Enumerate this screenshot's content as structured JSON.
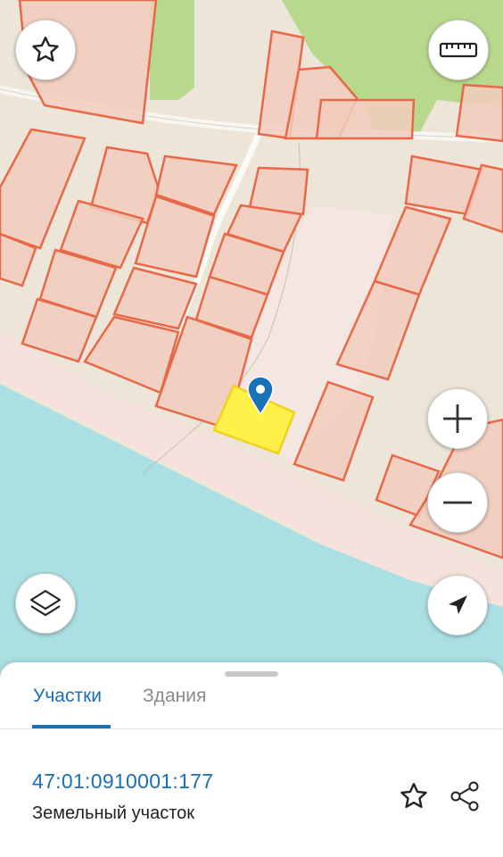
{
  "map": {
    "colors": {
      "land": "#ece5d8",
      "beach": "#f6e2dc",
      "water": "#aadfe3",
      "green": "#b8d98b",
      "parcel_fill": "#f2cdbd",
      "parcel_stroke": "#e8684a",
      "selected_fill": "#fff04a",
      "selected_stroke": "#f0d21a",
      "marker": "#1a73b8"
    },
    "controls": {
      "favorite": "star-outline-icon",
      "ruler": "ruler-icon",
      "zoom_in": "plus-icon",
      "zoom_out": "minus-icon",
      "layers": "layers-icon",
      "locate": "navigation-arrow-icon"
    }
  },
  "sheet": {
    "tabs": [
      {
        "label": "Участки",
        "active": true
      },
      {
        "label": "Здания",
        "active": false
      }
    ],
    "cadastral_number": "47:01:0910001:177",
    "parcel_type": "Земельный участок",
    "actions": {
      "favorite": "star-outline-icon",
      "share": "share-icon"
    }
  },
  "theme": {
    "accent": "#1a6fb5"
  }
}
